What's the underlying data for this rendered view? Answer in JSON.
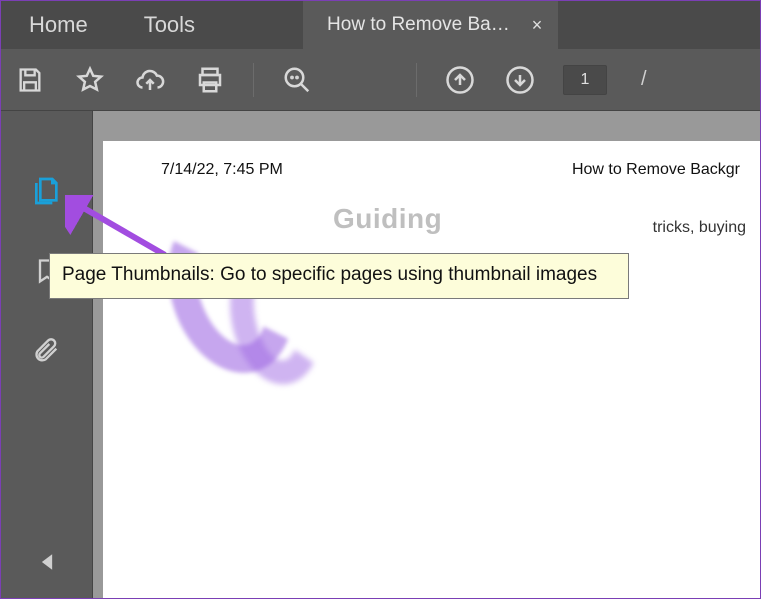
{
  "tabs": {
    "home": "Home",
    "tools": "Tools",
    "doc_title": "How to Remove Ba…",
    "close": "×"
  },
  "toolbar": {
    "page_number": "1",
    "page_sep": "/"
  },
  "sidebar": {
    "tooltip": "Page Thumbnails: Go to specific pages using thumbnail images"
  },
  "document": {
    "timestamp": "7/14/22, 7:45 PM",
    "header_right": "How to Remove Backgr",
    "logo_text": "Guiding",
    "tagline": "tricks, buying"
  }
}
